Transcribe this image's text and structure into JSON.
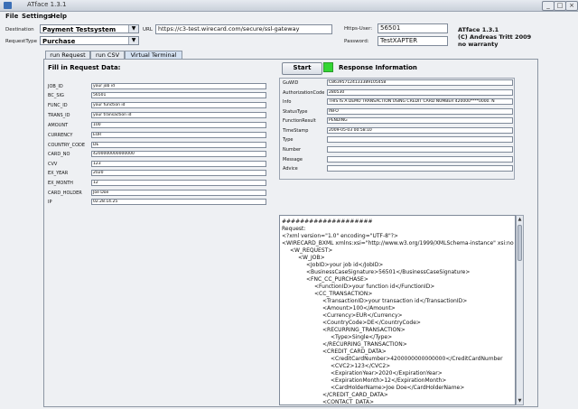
{
  "window": {
    "title": "ATface 1.3.1",
    "buttons": [
      "_",
      "□",
      "×"
    ]
  },
  "menu": [
    "File",
    "Settings",
    "Help"
  ],
  "top": {
    "destination_label": "Destination",
    "destination_value": "Payment Testsystem",
    "request_type_label": "RequestType",
    "request_type_value": "Purchase",
    "url_label": "URL",
    "url_value": "https://c3-test.wirecard.com/secure/ssl-gateway",
    "https_user_label": "Https-User:",
    "https_user_value": "56501",
    "password_label": "Password:",
    "password_value": "TestXAPTER",
    "about_line1": "ATface 1.3.1",
    "about_line2": "(C) Andreas Tritt 2009",
    "about_line3": "no warranty"
  },
  "tabs": [
    "run Request",
    "run CSV",
    "Virtual Terminal"
  ],
  "request": {
    "title": "Fill in Request Data:",
    "fields": [
      {
        "label": "JOB_ID",
        "value": "your job id"
      },
      {
        "label": "BC_SIG",
        "value": "56501"
      },
      {
        "label": "FUNC_ID",
        "value": "your function id"
      },
      {
        "label": "TRANS_ID",
        "value": "your transaction id"
      },
      {
        "label": "AMOUNT",
        "value": "100"
      },
      {
        "label": "CURRENCY",
        "value": "EUR"
      },
      {
        "label": "COUNTRY_CODE",
        "value": "DE"
      },
      {
        "label": "CARD_NO",
        "value": "4200000000000000"
      },
      {
        "label": "CVV",
        "value": "123"
      },
      {
        "label": "EX_YEAR",
        "value": "2020"
      },
      {
        "label": "EX_MONTH",
        "value": "12"
      },
      {
        "label": "CARD_HOLDER",
        "value": "Joe Doe"
      },
      {
        "label": "IP",
        "value": "02.28.14.25"
      }
    ]
  },
  "response": {
    "start_label": "Start",
    "title": "Response Information",
    "fields": [
      {
        "label": "GuWID",
        "value": "C863957124133389105458"
      },
      {
        "label": "AuthorizationCode",
        "value": "280530"
      },
      {
        "label": "Info",
        "value": "THIS IS A DEMO TRANSACTION USING CREDIT CARD NUMBER 420000****0000. N"
      },
      {
        "label": "StatusType",
        "value": "INFO"
      },
      {
        "label": "FunctionResult",
        "value": "PENDING"
      },
      {
        "label": "TimeStamp",
        "value": "2009-05-03 00:58:10"
      },
      {
        "label": "Type",
        "value": ""
      },
      {
        "label": "Number",
        "value": ""
      },
      {
        "label": "Message",
        "value": ""
      },
      {
        "label": "Advice",
        "value": ""
      }
    ]
  },
  "xml_lines": [
    {
      "indent": 0,
      "text": "####################"
    },
    {
      "indent": 0,
      "text": "Request:"
    },
    {
      "indent": 0,
      "text": "<?xml version=\"1.0\" encoding=\"UTF-8\"?>"
    },
    {
      "indent": 0,
      "text": "<WIRECARD_BXML xmlns:xsi=\"http://www.w3.org/1999/XMLSchema-instance\" xsi:no"
    },
    {
      "indent": 1,
      "text": "<W_REQUEST>"
    },
    {
      "indent": 2,
      "text": "<W_JOB>"
    },
    {
      "indent": 3,
      "text": "<JobID>your job id</JobID>"
    },
    {
      "indent": 3,
      "text": "<BusinessCaseSignature>56501</BusinessCaseSignature>"
    },
    {
      "indent": 3,
      "text": "<FNC_CC_PURCHASE>"
    },
    {
      "indent": 4,
      "text": "<FunctionID>your function id</FunctionID>"
    },
    {
      "indent": 4,
      "text": "<CC_TRANSACTION>"
    },
    {
      "indent": 5,
      "text": "<TransactionID>your transaction id</TransactionID>"
    },
    {
      "indent": 5,
      "text": "<Amount>100</Amount>"
    },
    {
      "indent": 5,
      "text": "<Currency>EUR</Currency>"
    },
    {
      "indent": 5,
      "text": "<CountryCode>DE</CountryCode>"
    },
    {
      "indent": 5,
      "text": "<RECURRING_TRANSACTION>"
    },
    {
      "indent": 6,
      "text": "<Type>Single</Type>"
    },
    {
      "indent": 5,
      "text": "</RECURRING_TRANSACTION>"
    },
    {
      "indent": 5,
      "text": "<CREDIT_CARD_DATA>"
    },
    {
      "indent": 6,
      "text": "<CreditCardNumber>4200000000000000</CreditCardNumber"
    },
    {
      "indent": 6,
      "text": "<CVC2>123</CVC2>"
    },
    {
      "indent": 6,
      "text": "<ExpirationYear>2020</ExpirationYear>"
    },
    {
      "indent": 6,
      "text": "<ExpirationMonth>12</ExpirationMonth>"
    },
    {
      "indent": 6,
      "text": "<CardHolderName>Joe Doe</CardHolderName>"
    },
    {
      "indent": 5,
      "text": "</CREDIT_CARD_DATA>"
    },
    {
      "indent": 5,
      "text": "<CONTACT_DATA>"
    }
  ],
  "icons": {
    "up": "▲",
    "down": "▼",
    "dropdown": "▼"
  }
}
